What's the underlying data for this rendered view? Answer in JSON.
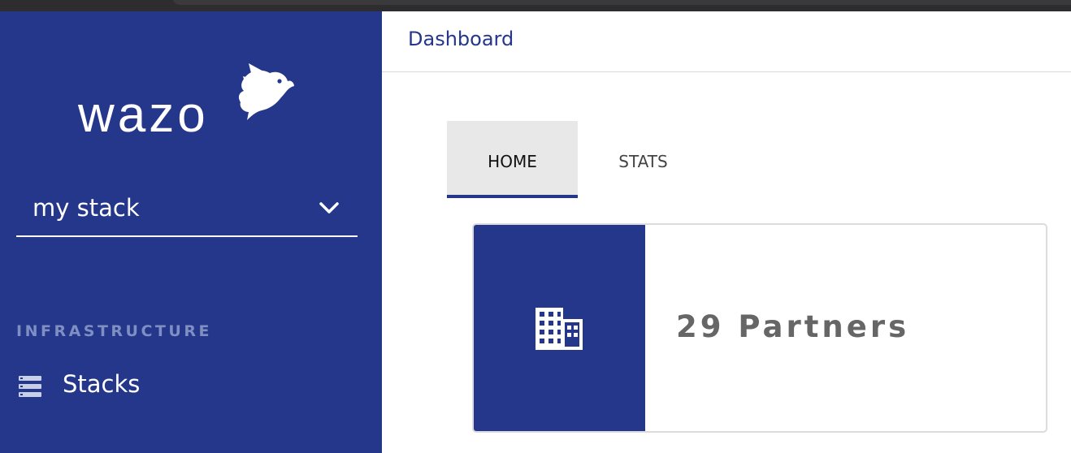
{
  "sidebar": {
    "logo_text": "wazo",
    "stack_selector": {
      "value": "my stack"
    },
    "section_label": "INFRASTRUCTURE",
    "items": [
      {
        "label": "Stacks",
        "icon": "server-list-icon"
      }
    ]
  },
  "header": {
    "title": "Dashboard"
  },
  "tabs": [
    {
      "label": "HOME",
      "active": true
    },
    {
      "label": "STATS",
      "active": false
    }
  ],
  "card": {
    "count": "29",
    "label": "Partners",
    "text": "29 Partners",
    "icon": "building-icon"
  },
  "colors": {
    "brand": "#25378b",
    "sidebar_bg": "#25378b",
    "section_label": "#7f8ec3",
    "tab_active_bg": "#e8e8e8",
    "card_text": "#666666"
  }
}
